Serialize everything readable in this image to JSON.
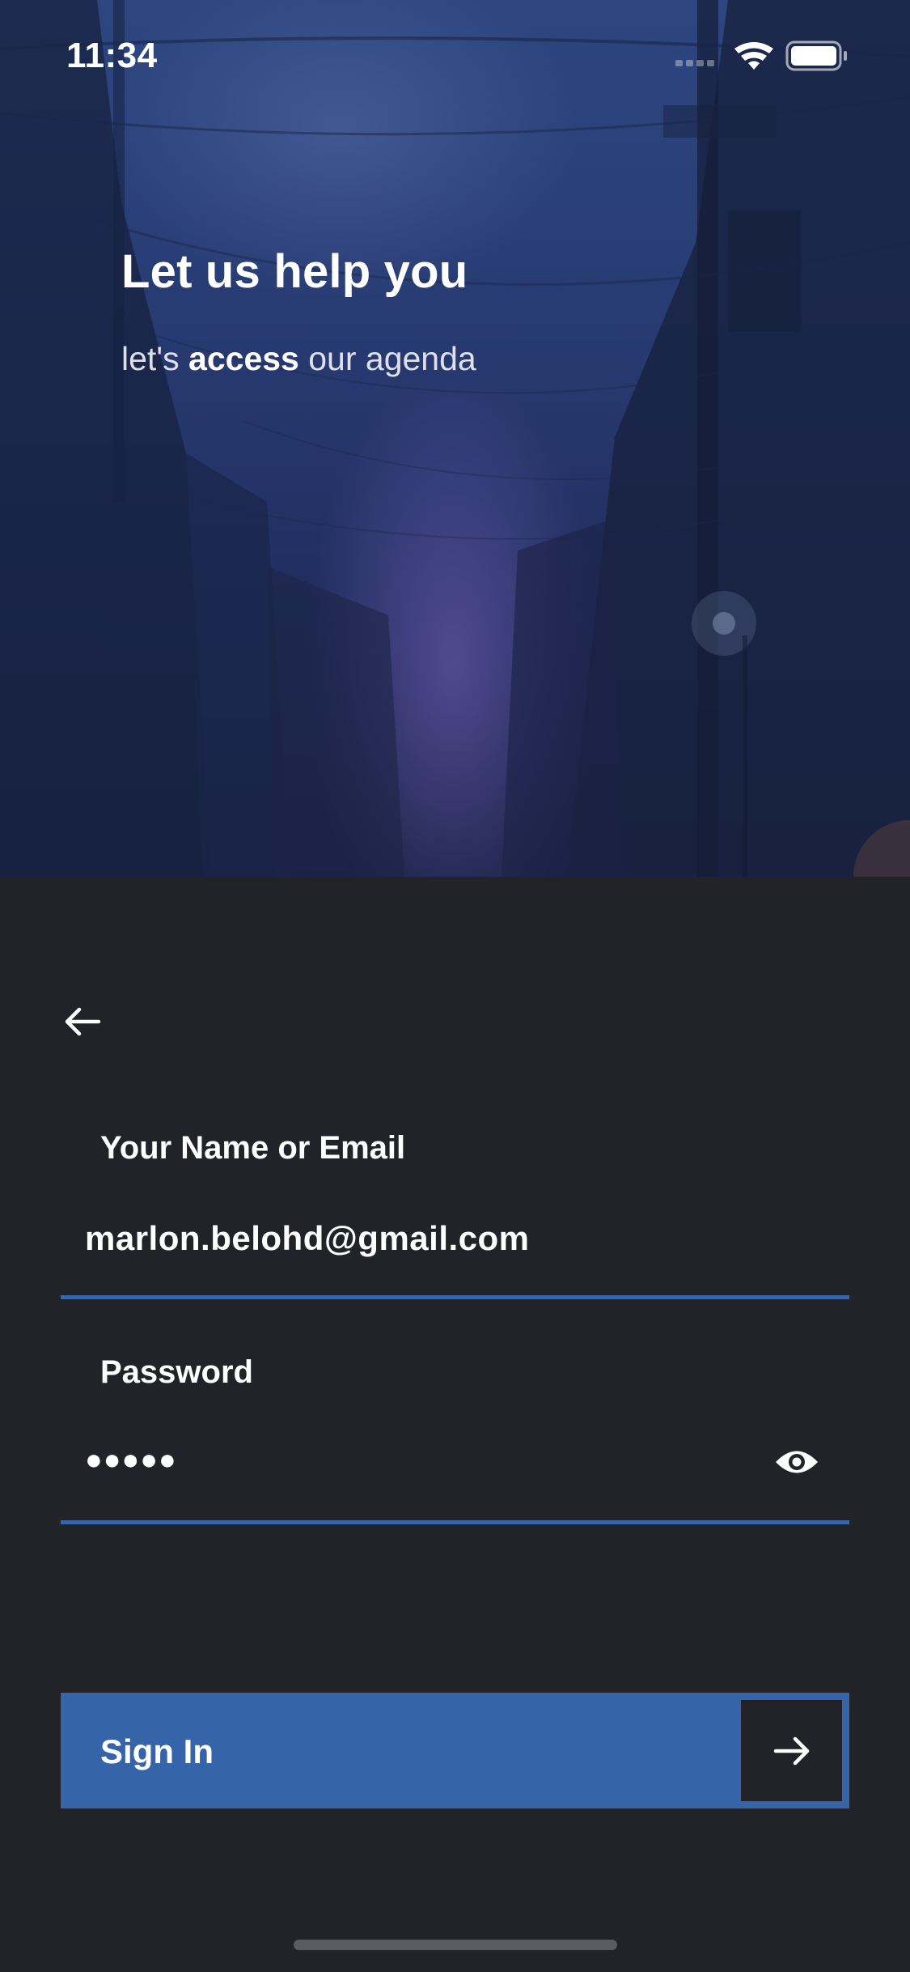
{
  "status_bar": {
    "time": "11:34",
    "signal_icon": "cellular-signal-icon",
    "wifi_icon": "wifi-icon",
    "battery_icon": "battery-icon"
  },
  "hero": {
    "title": "Let us help you",
    "subtitle_prefix": "let's ",
    "subtitle_emphasis": "access",
    "subtitle_suffix": " our agenda",
    "background_image": "blurred street scene with power lines at dusk"
  },
  "navigation": {
    "back_icon": "arrow-left-icon"
  },
  "form": {
    "email": {
      "label": "Your Name or Email",
      "value": "marlon.belohd@gmail.com"
    },
    "password": {
      "label": "Password",
      "masked_value": "●●●●●",
      "toggle_icon": "eye-icon"
    },
    "submit": {
      "label": "Sign In",
      "icon": "arrow-right-icon"
    }
  },
  "colors": {
    "background": "#212328",
    "accent": "#3565a8",
    "underline": "#3766aa",
    "text": "#ffffff"
  }
}
